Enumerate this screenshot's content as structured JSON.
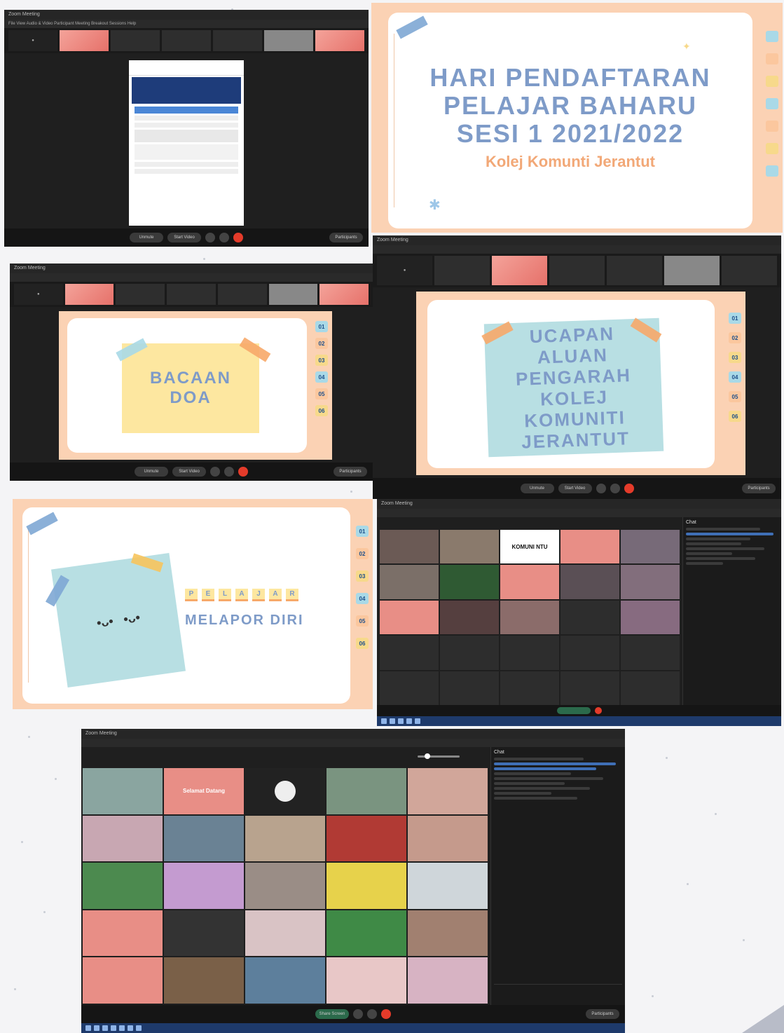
{
  "panel1": {
    "title": "Zoom Meeting",
    "menu": "File  View  Audio & Video  Participant  Meeting  Breakout Sessions  Help",
    "toolbar": [
      "Unmute",
      "Start Video",
      "Participants"
    ]
  },
  "panel2": {
    "line1": "HARI PENDAFTARAN",
    "line2": "PELAJAR BAHARU",
    "line3": "SESI 1 2021/2022",
    "subtitle": "Kolej Komunti Jerantut"
  },
  "panel3": {
    "title": "Zoom Meeting",
    "heading1": "BACAAN",
    "heading2": "DOA",
    "tabs": [
      "01",
      "02",
      "03",
      "04",
      "05",
      "06"
    ],
    "toolbar": [
      "Unmute",
      "Start Video",
      "Participants"
    ]
  },
  "panel4": {
    "title": "Zoom Meeting",
    "heading": [
      "UCAPAN",
      "ALUAN",
      "PENGARAH",
      "KOLEJ",
      "KOMUNITI",
      "JERANTUT"
    ],
    "tabs": [
      "01",
      "02",
      "03",
      "04",
      "05",
      "06"
    ],
    "toolbar": [
      "Unmute",
      "Start Video",
      "Participants"
    ]
  },
  "panel5": {
    "letters": [
      "P",
      "E",
      "L",
      "A",
      "J",
      "A",
      "R"
    ],
    "subheading": "MELAPOR DIRI",
    "tabs": [
      "01",
      "02",
      "03",
      "04",
      "05",
      "06"
    ]
  },
  "panel6": {
    "title": "Zoom Meeting",
    "chat_title": "Chat",
    "tile_text": "KOMUNI NTU"
  },
  "panel7": {
    "title": "Zoom Meeting",
    "chat_title": "Chat",
    "toolbar": [
      "Share Screen",
      "Participants"
    ],
    "tile_text": "Selamat Datang"
  },
  "colors": {
    "peach": "#fbd2b4",
    "slide_blue": "#7e9bc8",
    "orange_text": "#f2a877",
    "note_yellow": "#fde7a0",
    "note_teal": "#b8dfe3",
    "zoom_dark": "#1f1f1f",
    "end_red": "#e43b2a"
  }
}
